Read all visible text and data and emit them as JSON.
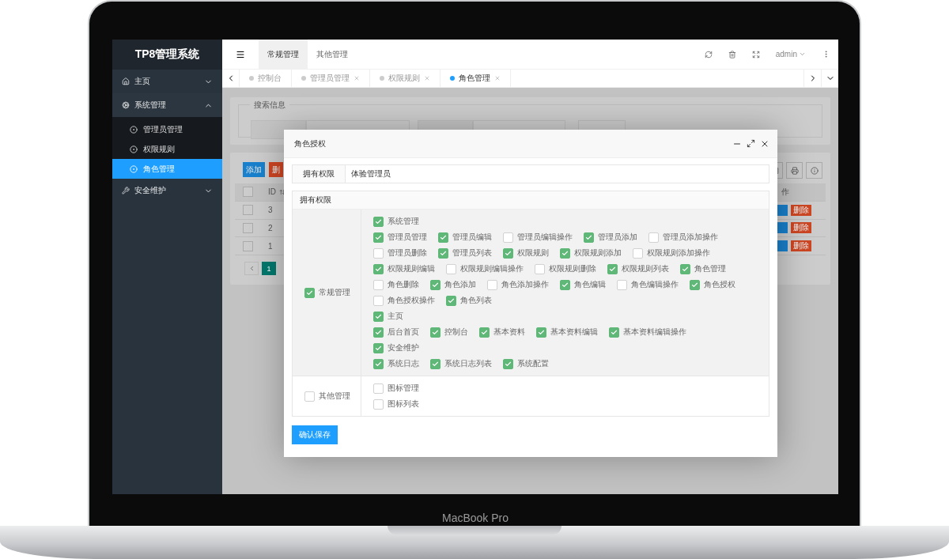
{
  "device": {
    "label": "MacBook Pro"
  },
  "app": {
    "title": "TP8管理系统"
  },
  "sidebar": [
    {
      "label": "主页",
      "expanded": false
    },
    {
      "label": "系统管理",
      "expanded": true,
      "children": [
        {
          "label": "管理员管理",
          "selected": false
        },
        {
          "label": "权限规则",
          "selected": false
        },
        {
          "label": "角色管理",
          "selected": true
        }
      ]
    },
    {
      "label": "安全维护",
      "expanded": false
    }
  ],
  "header": {
    "tabs": [
      {
        "label": "常规管理",
        "selected": true
      },
      {
        "label": "其他管理",
        "selected": false
      }
    ],
    "user": "admin"
  },
  "page_tabs": [
    {
      "label": "控制台",
      "selected": false,
      "closable": false
    },
    {
      "label": "管理员管理",
      "selected": false,
      "closable": true
    },
    {
      "label": "权限规则",
      "selected": false,
      "closable": true
    },
    {
      "label": "角色管理",
      "selected": true,
      "closable": true
    }
  ],
  "search_panel": {
    "legend": "搜索信息"
  },
  "toolbar": [
    {
      "label": "添加",
      "kind": "primary"
    },
    {
      "label": "删",
      "kind": "danger"
    }
  ],
  "table": {
    "header": {
      "checked": false,
      "id": "ID",
      "actions": "作"
    },
    "rows": [
      {
        "checked": false,
        "id": "3",
        "action": "删除"
      },
      {
        "checked": false,
        "id": "2",
        "action": "删除"
      },
      {
        "checked": false,
        "id": "1",
        "action": "删除"
      }
    ],
    "pages": [
      {
        "label": "1",
        "selected": true
      }
    ]
  },
  "modal": {
    "title": "角色授权",
    "field": {
      "label": "拥有权限",
      "value": "体验管理员"
    },
    "panel_title": "拥有权限",
    "groups": [
      {
        "label": "常规管理",
        "checked": true,
        "lines": [
          [
            {
              "label": "系统管理",
              "checked": true
            }
          ],
          [
            {
              "label": "管理员管理",
              "checked": true
            },
            {
              "label": "管理员编辑",
              "checked": true
            },
            {
              "label": "管理员编辑操作",
              "checked": false
            },
            {
              "label": "管理员添加",
              "checked": true
            },
            {
              "label": "管理员添加操作",
              "checked": false
            }
          ],
          [
            {
              "label": "管理员删除",
              "checked": false
            },
            {
              "label": "管理员列表",
              "checked": true
            },
            {
              "label": "权限规则",
              "checked": true
            },
            {
              "label": "权限规则添加",
              "checked": true
            },
            {
              "label": "权限规则添加操作",
              "checked": false
            }
          ],
          [
            {
              "label": "权限规则编辑",
              "checked": true
            },
            {
              "label": "权限规则编辑操作",
              "checked": false
            },
            {
              "label": "权限规则删除",
              "checked": false
            },
            {
              "label": "权限规则列表",
              "checked": true
            },
            {
              "label": "角色管理",
              "checked": true
            }
          ],
          [
            {
              "label": "角色删除",
              "checked": false
            },
            {
              "label": "角色添加",
              "checked": true
            },
            {
              "label": "角色添加操作",
              "checked": false
            },
            {
              "label": "角色编辑",
              "checked": true
            },
            {
              "label": "角色编辑操作",
              "checked": false
            },
            {
              "label": "角色授权",
              "checked": true
            }
          ],
          [
            {
              "label": "角色授权操作",
              "checked": false
            },
            {
              "label": "角色列表",
              "checked": true
            }
          ],
          [
            {
              "label": "主页",
              "checked": true
            }
          ],
          [
            {
              "label": "后台首页",
              "checked": true
            },
            {
              "label": "控制台",
              "checked": true
            },
            {
              "label": "基本资料",
              "checked": true
            },
            {
              "label": "基本资料编辑",
              "checked": true
            },
            {
              "label": "基本资料编辑操作",
              "checked": true
            }
          ],
          [
            {
              "label": "安全维护",
              "checked": true
            }
          ],
          [
            {
              "label": "系统日志",
              "checked": true
            },
            {
              "label": "系统日志列表",
              "checked": true
            },
            {
              "label": "系统配置",
              "checked": true
            }
          ]
        ]
      },
      {
        "label": "其他管理",
        "checked": false,
        "lines": [
          [
            {
              "label": "图标管理",
              "checked": false
            }
          ],
          [
            {
              "label": "图标列表",
              "checked": false
            }
          ]
        ]
      }
    ],
    "submit": "确认保存"
  }
}
